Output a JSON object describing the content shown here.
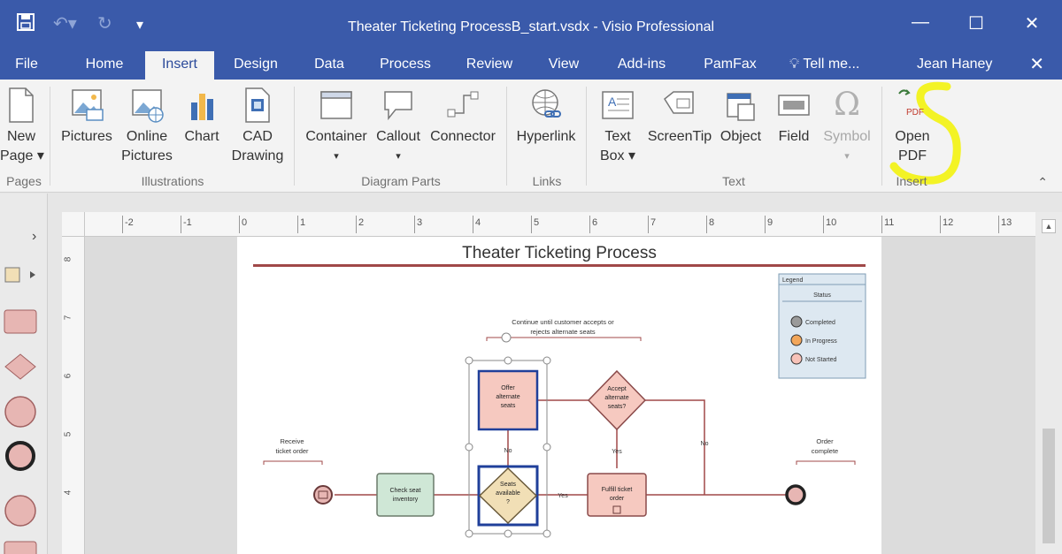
{
  "title_bar": {
    "title": "Theater Ticketing ProcessB_start.vsdx - Visio Professional",
    "save_icon": "save-icon",
    "undo_icon": "undo-icon",
    "redo_icon": "redo-icon",
    "customize_icon": "customize-qat-icon",
    "minimize": "—",
    "maximize": "☐",
    "close": "✕"
  },
  "tabs": [
    {
      "label": "File"
    },
    {
      "label": "Home"
    },
    {
      "label": "Insert"
    },
    {
      "label": "Design"
    },
    {
      "label": "Data"
    },
    {
      "label": "Process"
    },
    {
      "label": "Review"
    },
    {
      "label": "View"
    },
    {
      "label": "Add-ins"
    },
    {
      "label": "PamFax"
    }
  ],
  "tell_me": "Tell me...",
  "user_name": "Jean Haney",
  "ribbon_close": "✕",
  "ribbon": {
    "buttons": {
      "new_page": {
        "line1": "New",
        "line2": "Page ▾"
      },
      "pictures": {
        "line1": "Pictures"
      },
      "online_pictures": {
        "line1": "Online",
        "line2": "Pictures"
      },
      "chart": {
        "line1": "Chart"
      },
      "cad_drawing": {
        "line1": "CAD",
        "line2": "Drawing"
      },
      "container": {
        "line1": "Container",
        "line2": "▾"
      },
      "callout": {
        "line1": "Callout",
        "line2": "▾"
      },
      "connector": {
        "line1": "Connector"
      },
      "hyperlink": {
        "line1": "Hyperlink"
      },
      "text_box": {
        "line1": "Text",
        "line2": "Box ▾"
      },
      "screentip": {
        "line1": "ScreenTip"
      },
      "object": {
        "line1": "Object"
      },
      "field": {
        "line1": "Field"
      },
      "symbol": {
        "line1": "Symbol",
        "line2": "▾"
      },
      "open_pdf": {
        "line1": "Open",
        "line2": "PDF",
        "icon_text": "PDF"
      }
    },
    "groups": {
      "pages": "Pages",
      "illustrations": "Illustrations",
      "diagram_parts": "Diagram Parts",
      "links": "Links",
      "text": "Text",
      "insert": "Insert"
    },
    "collapse": "⌃",
    "highlight_color": "#f2f200"
  },
  "ruler": {
    "h_ticks": [
      "-2",
      "-1",
      "0",
      "1",
      "2",
      "3",
      "4",
      "5",
      "6",
      "7",
      "8",
      "9",
      "10",
      "11",
      "12",
      "13"
    ],
    "v_ticks": [
      "8",
      "7",
      "6",
      "5",
      "4"
    ]
  },
  "diagram": {
    "title": "Theater Ticketing Process",
    "legend": {
      "title": "Legend",
      "subtitle": "Status",
      "items": [
        {
          "label": "Completed",
          "color": "#9a9a9a"
        },
        {
          "label": "In Progress",
          "color": "#f2a65a"
        },
        {
          "label": "Not Started",
          "color": "#f7c2b8"
        }
      ]
    },
    "annotations": {
      "top": [
        "Continue until customer accepts or",
        "rejects alternate seats"
      ],
      "start": [
        "Receive",
        "ticket order"
      ],
      "end": [
        "Order",
        "complete"
      ]
    },
    "shapes": {
      "check_seat": [
        "Check seat",
        "inventory"
      ],
      "seats_available": [
        "Seats",
        "available",
        "?"
      ],
      "offer_alternate": [
        "Offer",
        "alternate",
        "seats"
      ],
      "accept_alternate": [
        "Accept",
        "alternate",
        "seats?"
      ],
      "fulfill_order": [
        "Fulfill ticket",
        "order"
      ]
    },
    "labels": {
      "no1": "No",
      "yes1": "Yes",
      "yes2": "Yes",
      "no2": "No"
    },
    "colors": {
      "line": "#a04848",
      "title_rule": "#a04848",
      "shape_fill_pink": "#f6c9c0",
      "shape_fill_green": "#cfe7d6",
      "shape_fill_tan": "#f1dfb6",
      "selected_border": "#1f3f9a"
    }
  },
  "shapes_pane": {
    "expand": "›",
    "items": [
      "stencil-icon",
      "rectangle-shape",
      "diamond-shape",
      "circle-shape",
      "thick-circle-shape",
      "circle-shape-2",
      "rectangle-shape-2"
    ]
  }
}
